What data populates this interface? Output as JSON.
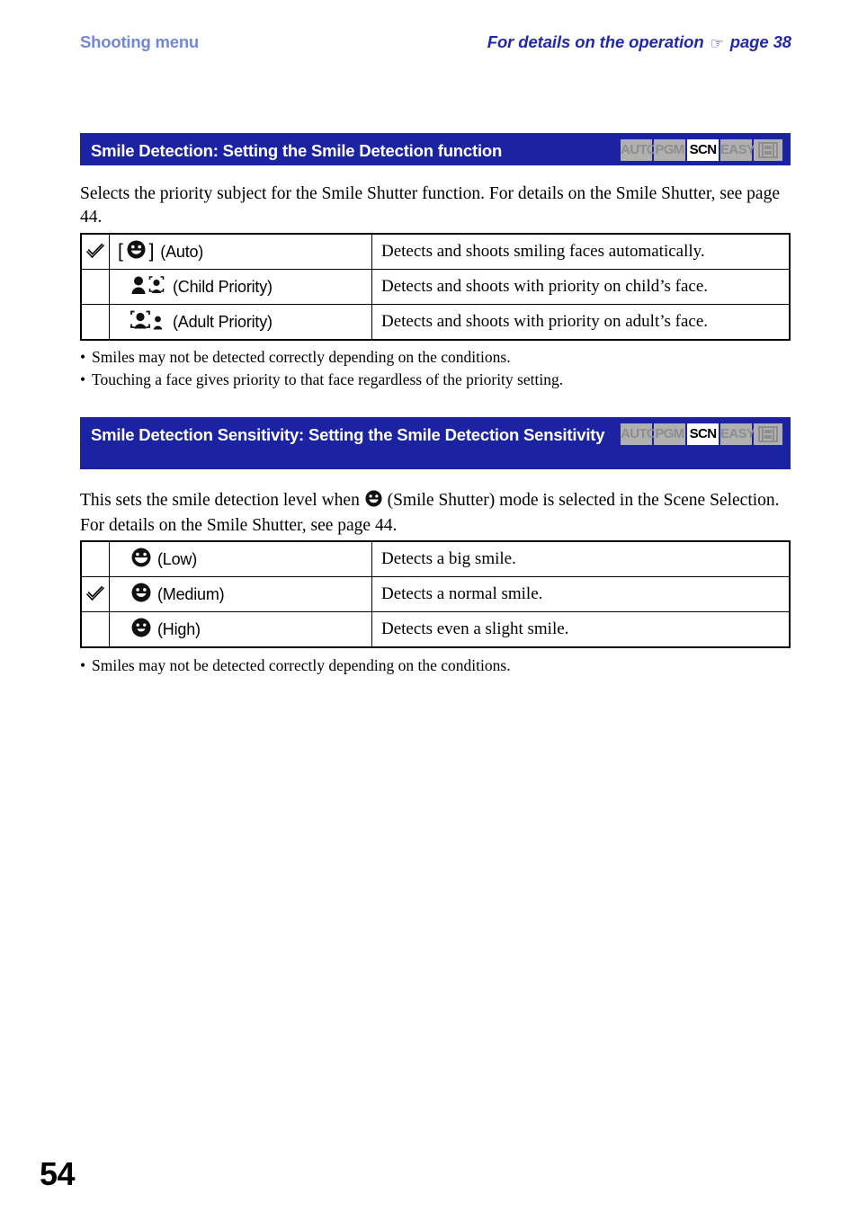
{
  "running_head": {
    "left_label": "Shooting menu",
    "right_prefix": "For details on the operation",
    "right_hand_icon": "pointing-hand-icon",
    "right_suffix": "page 38",
    "left_color": "#7287d6",
    "right_color": "#2229a8"
  },
  "theme": {
    "bar_blue": "#1b23a2",
    "badge_inactive_bg": "#b0b0b0",
    "badge_inactive_fg": "#8e8e8e",
    "badge_active_bg": "#ffffff",
    "badge_active_fg": "#000000"
  },
  "mode_badges": [
    {
      "label": "AUTO",
      "active": false
    },
    {
      "label": "PGM",
      "active": false
    },
    {
      "label": "SCN",
      "active": true
    },
    {
      "label": "EASY",
      "active": false
    },
    {
      "label": "",
      "active": false,
      "icon": "movie-mode-icon"
    }
  ],
  "sections": [
    {
      "title": "Smile Detection: Setting the Smile Detection function",
      "intro": "Selects the priority subject for the Smile Shutter function. For details on the Smile Shutter, see page 44.",
      "table": {
        "rows": [
          {
            "checked": true,
            "icon": "smile-bracket-icon",
            "name": "(Auto)",
            "bracket_open": "[",
            "bracket_close": "]",
            "description": "Detects and shoots smiling faces automatically."
          },
          {
            "checked": false,
            "icon": "child-priority-icon",
            "name": "(Child Priority)",
            "description": "Detects and shoots with priority on child’s face."
          },
          {
            "checked": false,
            "icon": "adult-priority-icon",
            "name": "(Adult Priority)",
            "description": "Detects and shoots with priority on adult’s face."
          }
        ]
      },
      "notes": [
        "Smiles may not be detected correctly depending on the conditions.",
        "Touching a face gives priority to that face regardless of the priority setting."
      ]
    },
    {
      "title": "Smile Detection Sensitivity: Setting the Smile Detection Sensitivity",
      "intro_part1": "This sets the smile detection level when",
      "intro_icon": "smile-shutter-icon",
      "intro_part2": "(Smile Shutter) mode is selected in the Scene Selection. For details on the Smile Shutter, see page 44.",
      "table": {
        "rows": [
          {
            "checked": false,
            "icon": "smile-big-icon",
            "name": "(Low)",
            "description": "Detects a big smile."
          },
          {
            "checked": true,
            "icon": "smile-normal-icon",
            "name": "(Medium)",
            "description": "Detects a normal smile."
          },
          {
            "checked": false,
            "icon": "smile-slight-icon",
            "name": "(High)",
            "description": "Detects even a slight smile."
          }
        ]
      },
      "notes": [
        "Smiles may not be detected correctly depending on the conditions."
      ]
    }
  ],
  "page_number": "54"
}
